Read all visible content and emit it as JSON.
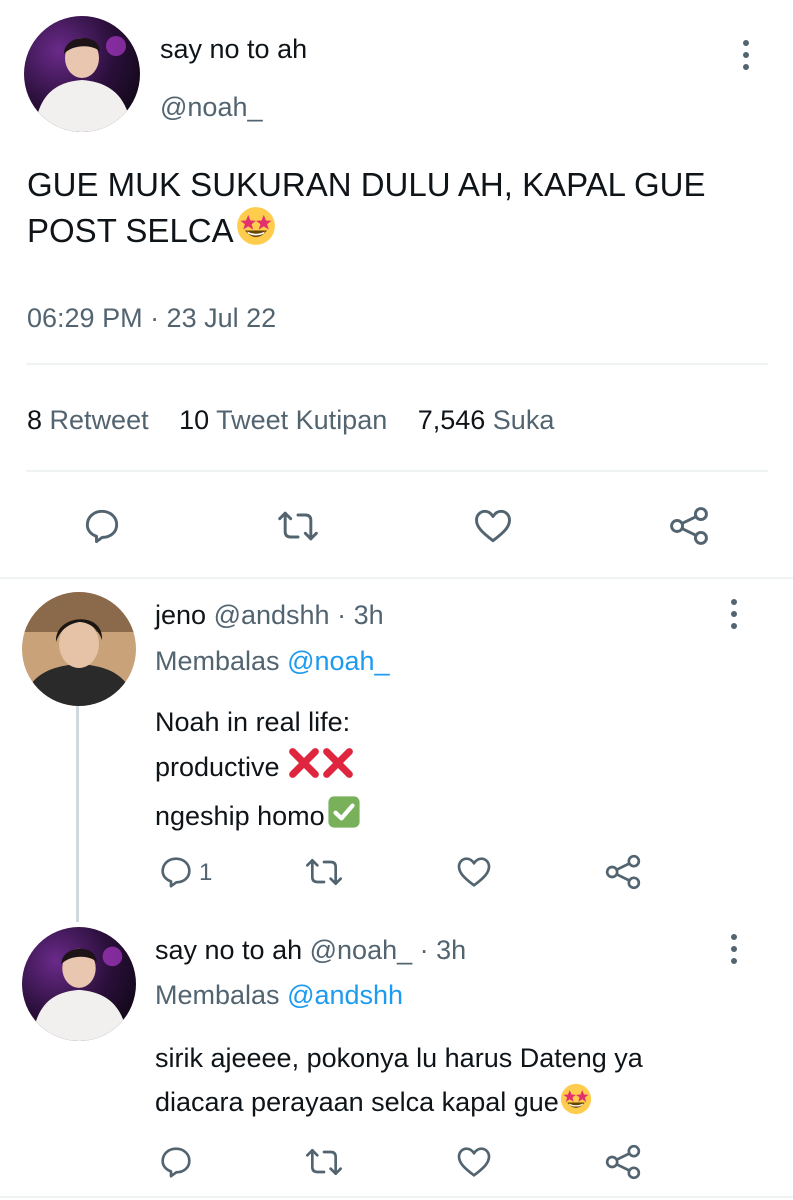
{
  "main_tweet": {
    "display_name": "say no to ah",
    "handle": "@noah_",
    "text": "GUE MUK SUKURAN DULU AH, KAPAL GUE POST SELCA",
    "text_line1": "GUE MUK SUKURAN DULU AH, KAPAL GUE",
    "text_line2": "POST SELCA",
    "emoji": "star-struck",
    "timestamp": "06:29 PM · 23 Jul 22",
    "stats": {
      "retweets_count": "8",
      "retweets_label": "Retweet",
      "quotes_count": "10",
      "quotes_label": "Tweet Kutipan",
      "likes_count": "7,546",
      "likes_label": "Suka"
    }
  },
  "replies": [
    {
      "display_name": "jeno",
      "handle": "@andshh",
      "separator": "·",
      "time": "3h",
      "replying_label": "Membalas",
      "replying_to": "@noah_",
      "lines": [
        "Noah in real life:",
        "productive",
        "ngeship homo"
      ],
      "reply_count": "1"
    },
    {
      "display_name": "say no to ah",
      "handle": "@noah_",
      "separator": "·",
      "time": "3h",
      "replying_label": "Membalas",
      "replying_to": "@andshh",
      "lines": [
        "sirik ajeeee, pokonya lu harus Dateng ya",
        "diacara perayaan selca kapal gue"
      ]
    }
  ],
  "colors": {
    "link": "#1d9bf0",
    "muted": "#536471",
    "text": "#0f1419",
    "divider": "#eff3f4"
  }
}
